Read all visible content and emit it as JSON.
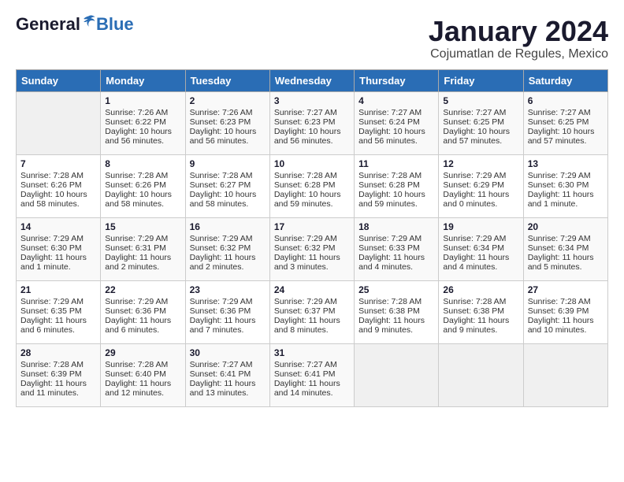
{
  "header": {
    "logo_general": "General",
    "logo_blue": "Blue",
    "month_title": "January 2024",
    "location": "Cojumatlan de Regules, Mexico"
  },
  "days_of_week": [
    "Sunday",
    "Monday",
    "Tuesday",
    "Wednesday",
    "Thursday",
    "Friday",
    "Saturday"
  ],
  "weeks": [
    [
      {
        "day": "",
        "sunrise": "",
        "sunset": "",
        "daylight": ""
      },
      {
        "day": "1",
        "sunrise": "Sunrise: 7:26 AM",
        "sunset": "Sunset: 6:22 PM",
        "daylight": "Daylight: 10 hours and 56 minutes."
      },
      {
        "day": "2",
        "sunrise": "Sunrise: 7:26 AM",
        "sunset": "Sunset: 6:23 PM",
        "daylight": "Daylight: 10 hours and 56 minutes."
      },
      {
        "day": "3",
        "sunrise": "Sunrise: 7:27 AM",
        "sunset": "Sunset: 6:23 PM",
        "daylight": "Daylight: 10 hours and 56 minutes."
      },
      {
        "day": "4",
        "sunrise": "Sunrise: 7:27 AM",
        "sunset": "Sunset: 6:24 PM",
        "daylight": "Daylight: 10 hours and 56 minutes."
      },
      {
        "day": "5",
        "sunrise": "Sunrise: 7:27 AM",
        "sunset": "Sunset: 6:25 PM",
        "daylight": "Daylight: 10 hours and 57 minutes."
      },
      {
        "day": "6",
        "sunrise": "Sunrise: 7:27 AM",
        "sunset": "Sunset: 6:25 PM",
        "daylight": "Daylight: 10 hours and 57 minutes."
      }
    ],
    [
      {
        "day": "7",
        "sunrise": "Sunrise: 7:28 AM",
        "sunset": "Sunset: 6:26 PM",
        "daylight": "Daylight: 10 hours and 58 minutes."
      },
      {
        "day": "8",
        "sunrise": "Sunrise: 7:28 AM",
        "sunset": "Sunset: 6:26 PM",
        "daylight": "Daylight: 10 hours and 58 minutes."
      },
      {
        "day": "9",
        "sunrise": "Sunrise: 7:28 AM",
        "sunset": "Sunset: 6:27 PM",
        "daylight": "Daylight: 10 hours and 58 minutes."
      },
      {
        "day": "10",
        "sunrise": "Sunrise: 7:28 AM",
        "sunset": "Sunset: 6:28 PM",
        "daylight": "Daylight: 10 hours and 59 minutes."
      },
      {
        "day": "11",
        "sunrise": "Sunrise: 7:28 AM",
        "sunset": "Sunset: 6:28 PM",
        "daylight": "Daylight: 10 hours and 59 minutes."
      },
      {
        "day": "12",
        "sunrise": "Sunrise: 7:29 AM",
        "sunset": "Sunset: 6:29 PM",
        "daylight": "Daylight: 11 hours and 0 minutes."
      },
      {
        "day": "13",
        "sunrise": "Sunrise: 7:29 AM",
        "sunset": "Sunset: 6:30 PM",
        "daylight": "Daylight: 11 hours and 1 minute."
      }
    ],
    [
      {
        "day": "14",
        "sunrise": "Sunrise: 7:29 AM",
        "sunset": "Sunset: 6:30 PM",
        "daylight": "Daylight: 11 hours and 1 minute."
      },
      {
        "day": "15",
        "sunrise": "Sunrise: 7:29 AM",
        "sunset": "Sunset: 6:31 PM",
        "daylight": "Daylight: 11 hours and 2 minutes."
      },
      {
        "day": "16",
        "sunrise": "Sunrise: 7:29 AM",
        "sunset": "Sunset: 6:32 PM",
        "daylight": "Daylight: 11 hours and 2 minutes."
      },
      {
        "day": "17",
        "sunrise": "Sunrise: 7:29 AM",
        "sunset": "Sunset: 6:32 PM",
        "daylight": "Daylight: 11 hours and 3 minutes."
      },
      {
        "day": "18",
        "sunrise": "Sunrise: 7:29 AM",
        "sunset": "Sunset: 6:33 PM",
        "daylight": "Daylight: 11 hours and 4 minutes."
      },
      {
        "day": "19",
        "sunrise": "Sunrise: 7:29 AM",
        "sunset": "Sunset: 6:34 PM",
        "daylight": "Daylight: 11 hours and 4 minutes."
      },
      {
        "day": "20",
        "sunrise": "Sunrise: 7:29 AM",
        "sunset": "Sunset: 6:34 PM",
        "daylight": "Daylight: 11 hours and 5 minutes."
      }
    ],
    [
      {
        "day": "21",
        "sunrise": "Sunrise: 7:29 AM",
        "sunset": "Sunset: 6:35 PM",
        "daylight": "Daylight: 11 hours and 6 minutes."
      },
      {
        "day": "22",
        "sunrise": "Sunrise: 7:29 AM",
        "sunset": "Sunset: 6:36 PM",
        "daylight": "Daylight: 11 hours and 6 minutes."
      },
      {
        "day": "23",
        "sunrise": "Sunrise: 7:29 AM",
        "sunset": "Sunset: 6:36 PM",
        "daylight": "Daylight: 11 hours and 7 minutes."
      },
      {
        "day": "24",
        "sunrise": "Sunrise: 7:29 AM",
        "sunset": "Sunset: 6:37 PM",
        "daylight": "Daylight: 11 hours and 8 minutes."
      },
      {
        "day": "25",
        "sunrise": "Sunrise: 7:28 AM",
        "sunset": "Sunset: 6:38 PM",
        "daylight": "Daylight: 11 hours and 9 minutes."
      },
      {
        "day": "26",
        "sunrise": "Sunrise: 7:28 AM",
        "sunset": "Sunset: 6:38 PM",
        "daylight": "Daylight: 11 hours and 9 minutes."
      },
      {
        "day": "27",
        "sunrise": "Sunrise: 7:28 AM",
        "sunset": "Sunset: 6:39 PM",
        "daylight": "Daylight: 11 hours and 10 minutes."
      }
    ],
    [
      {
        "day": "28",
        "sunrise": "Sunrise: 7:28 AM",
        "sunset": "Sunset: 6:39 PM",
        "daylight": "Daylight: 11 hours and 11 minutes."
      },
      {
        "day": "29",
        "sunrise": "Sunrise: 7:28 AM",
        "sunset": "Sunset: 6:40 PM",
        "daylight": "Daylight: 11 hours and 12 minutes."
      },
      {
        "day": "30",
        "sunrise": "Sunrise: 7:27 AM",
        "sunset": "Sunset: 6:41 PM",
        "daylight": "Daylight: 11 hours and 13 minutes."
      },
      {
        "day": "31",
        "sunrise": "Sunrise: 7:27 AM",
        "sunset": "Sunset: 6:41 PM",
        "daylight": "Daylight: 11 hours and 14 minutes."
      },
      {
        "day": "",
        "sunrise": "",
        "sunset": "",
        "daylight": ""
      },
      {
        "day": "",
        "sunrise": "",
        "sunset": "",
        "daylight": ""
      },
      {
        "day": "",
        "sunrise": "",
        "sunset": "",
        "daylight": ""
      }
    ]
  ]
}
